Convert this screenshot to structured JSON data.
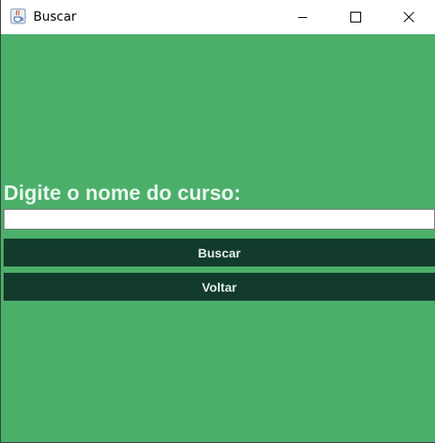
{
  "window": {
    "title": "Buscar",
    "app_icon": "java-coffee-cup-icon"
  },
  "title_controls": {
    "minimize_icon": "minimize-icon",
    "maximize_icon": "maximize-icon",
    "close_icon": "close-icon"
  },
  "form": {
    "prompt": "Digite o nome do curso:",
    "course_name_value": "",
    "search_label": "Buscar",
    "back_label": "Voltar"
  },
  "colors": {
    "background": "#4baf6a",
    "button": "#123b2b",
    "label_text": "#e9f7ee",
    "button_text": "#e3ecef"
  }
}
